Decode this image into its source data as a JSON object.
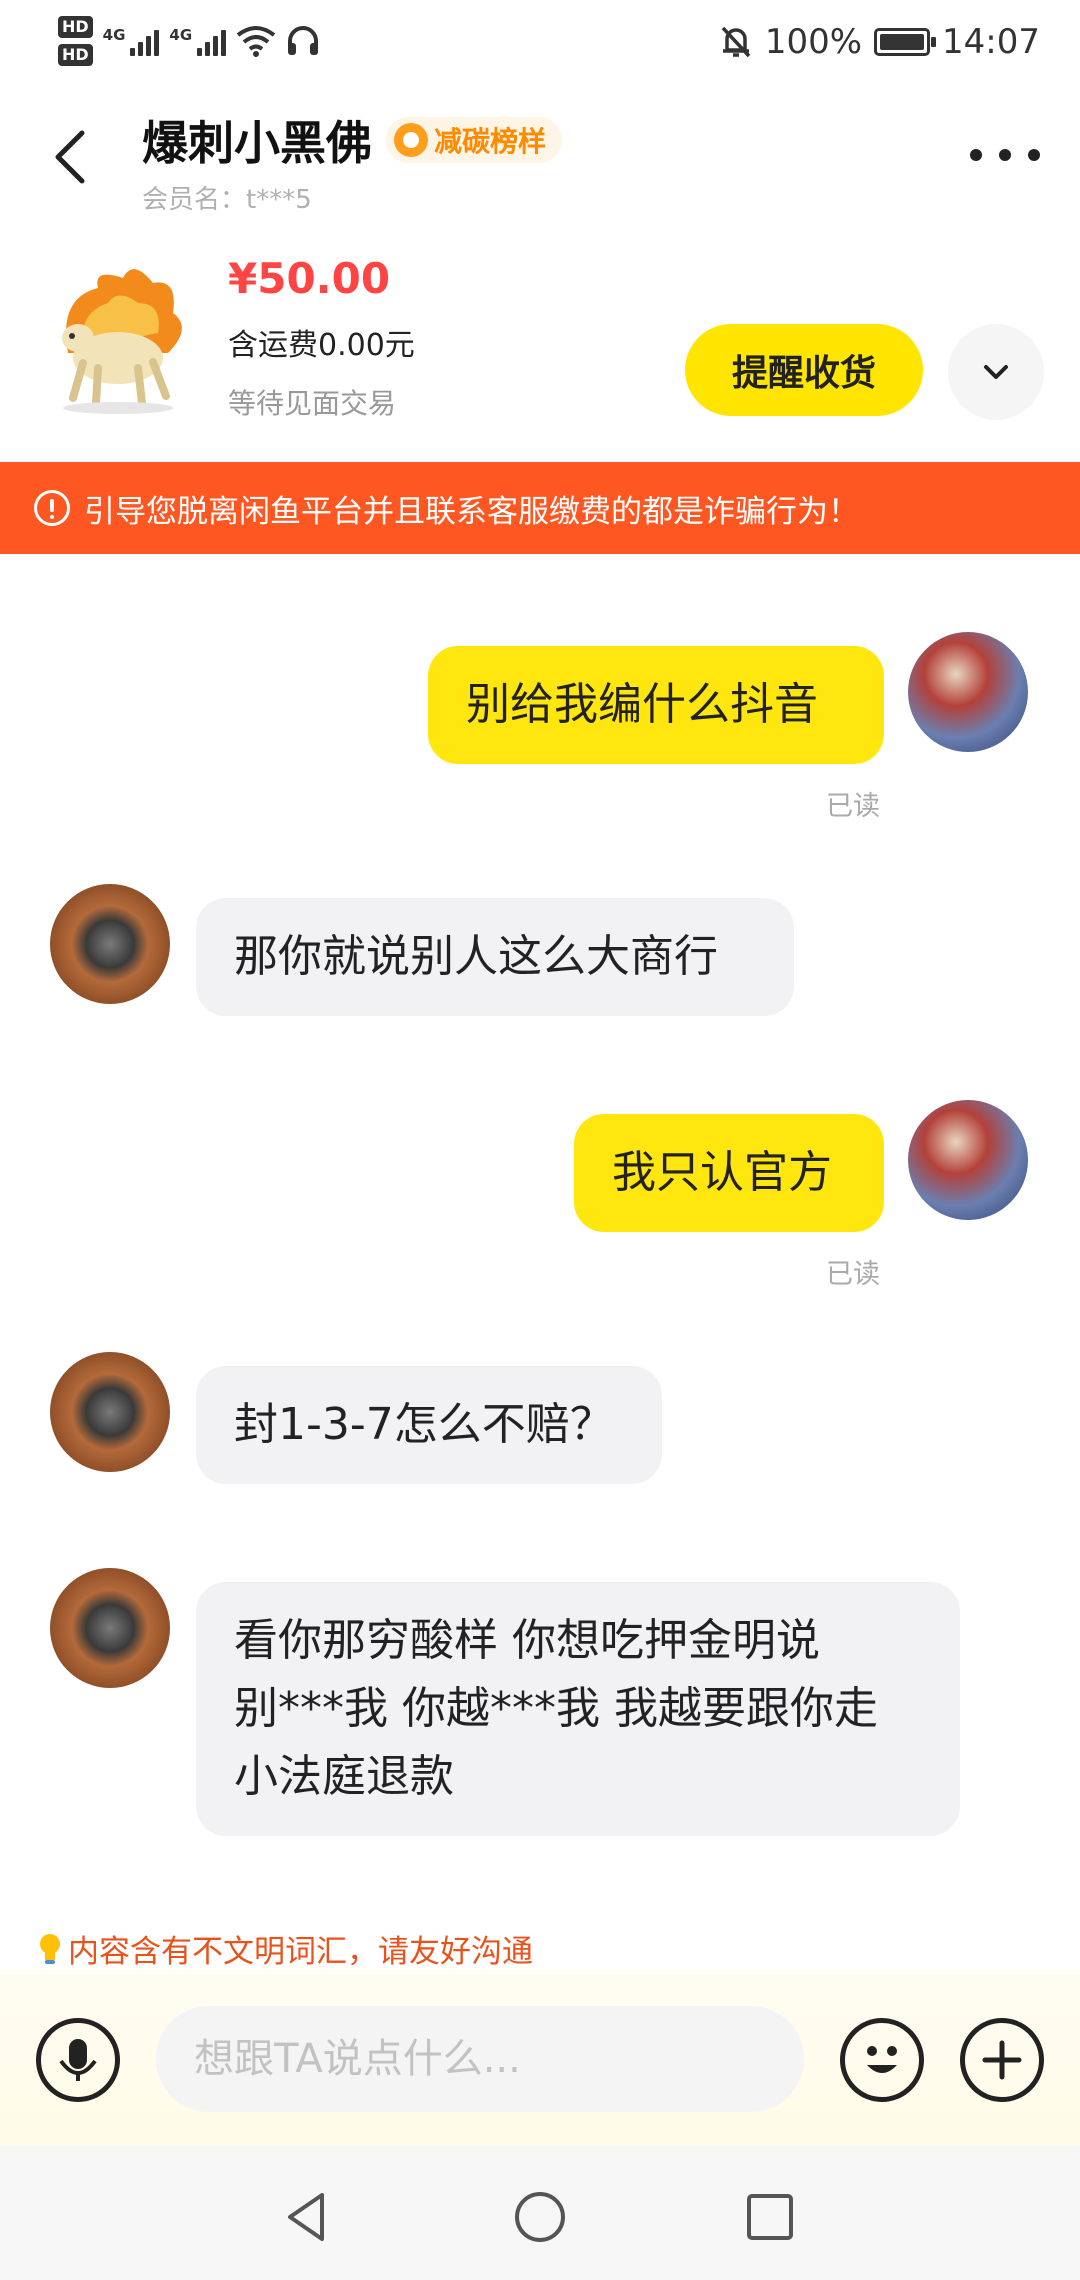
{
  "status_bar": {
    "hd1": "HD",
    "hd2": "HD",
    "sim1_network": "4G",
    "sim2_network": "4G",
    "battery": "100%",
    "battery_level": 1.0,
    "time": "14:07"
  },
  "header": {
    "seller_name": "爆刺小黑佛",
    "badge": "减碳榜样",
    "member_name": "会员名：t***5"
  },
  "product": {
    "price": "¥50.00",
    "shipping": "含运费0.00元",
    "status": "等待见面交易",
    "remind_button": "提醒收货"
  },
  "warning": "引导您脱离闲鱼平台并且联系客服缴费的都是诈骗行为！",
  "messages": [
    {
      "sender": "me",
      "text": "别给我编什么抖音",
      "status": "已读"
    },
    {
      "sender": "them",
      "text": "那你就说别人这么大商行"
    },
    {
      "sender": "me",
      "text": "我只认官方",
      "status": "已读"
    },
    {
      "sender": "them",
      "text": "封1-3-7怎么不赔？"
    },
    {
      "sender": "them",
      "lines": [
        "看你那穷酸样 你想吃押金明说",
        "别***我 你越***我 我越要跟你走",
        "小法庭退款"
      ]
    }
  ],
  "tip": "内容含有不文明词汇，请友好沟通",
  "input": {
    "placeholder": "想跟TA说点什么..."
  },
  "colors": {
    "accent_yellow": "#ffe60f",
    "warning_orange": "#ff5722",
    "price_red": "#ff4444",
    "tip_orange": "#e8531b"
  },
  "icons": [
    "back-arrow-icon",
    "more-dots-icon",
    "chevron-down-icon",
    "warning-icon",
    "bulb-icon",
    "microphone-icon",
    "emoji-icon",
    "plus-icon",
    "nav-back-icon",
    "nav-home-icon",
    "nav-recents-icon"
  ]
}
